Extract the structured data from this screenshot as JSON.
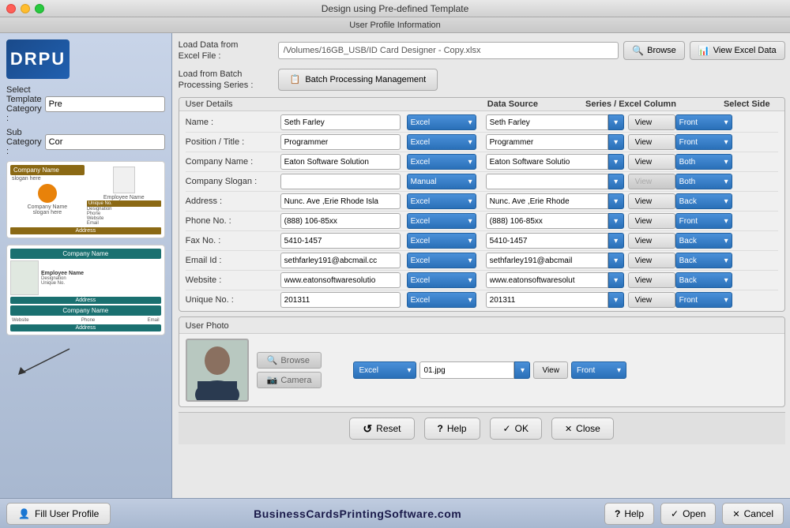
{
  "window": {
    "title": "Design using Pre-defined Template",
    "subtitle": "User Profile Information"
  },
  "sidebar": {
    "logo": "DRPU",
    "select_template_label": "Select Template Category :",
    "select_template_value": "Pre",
    "sub_category_label": "Sub Category :",
    "sub_category_value": "Cor"
  },
  "file_section": {
    "load_data_label": "Load Data from\nExcel File :",
    "file_path": "/Volumes/16GB_USB/ID Card Designer - Copy.xlsx",
    "browse_label": "Browse",
    "view_excel_label": "View Excel Data",
    "load_batch_label": "Load from Batch\nProcessing Series :",
    "batch_label": "Batch Processing Management"
  },
  "user_details": {
    "section_title": "User Details",
    "col_data_source": "Data Source",
    "col_series": "Series / Excel Column",
    "col_select_side": "Select Side",
    "fields": [
      {
        "label": "Name :",
        "value": "Seth Farley",
        "source": "Excel",
        "series_value": "Seth Farley",
        "view": "View",
        "side": "Front"
      },
      {
        "label": "Position / Title :",
        "value": "Programmer",
        "source": "Excel",
        "series_value": "Programmer",
        "view": "View",
        "side": "Front"
      },
      {
        "label": "Company Name :",
        "value": "Eaton Software Solution",
        "source": "Excel",
        "series_value": "Eaton Software Solutio",
        "view": "View",
        "side": "Both"
      },
      {
        "label": "Company Slogan :",
        "value": "",
        "source": "Manual",
        "series_value": "",
        "view": "View",
        "side": "Both",
        "view_disabled": true
      },
      {
        "label": "Address :",
        "value": "Nunc. Ave ,Erie Rhode Isla",
        "source": "Excel",
        "series_value": "Nunc. Ave ,Erie Rhode",
        "view": "View",
        "side": "Back"
      },
      {
        "label": "Phone No. :",
        "value": "(888) 106-85xx",
        "source": "Excel",
        "series_value": "(888) 106-85xx",
        "view": "View",
        "side": "Front"
      },
      {
        "label": "Fax No. :",
        "value": "5410-1457",
        "source": "Excel",
        "series_value": "5410-1457",
        "view": "View",
        "side": "Back"
      },
      {
        "label": "Email Id :",
        "value": "sethfarley191@abcmail.cc",
        "source": "Excel",
        "series_value": "sethfarley191@abcmail",
        "view": "View",
        "side": "Back"
      },
      {
        "label": "Website :",
        "value": "www.eatonsoftwaresolutio",
        "source": "Excel",
        "series_value": "www.eatonsoftwaresolut",
        "view": "View",
        "side": "Back"
      },
      {
        "label": "Unique No. :",
        "value": "201311",
        "source": "Excel",
        "series_value": "201311",
        "view": "View",
        "side": "Front"
      }
    ]
  },
  "user_photo": {
    "section_title": "User Photo",
    "browse_label": "Browse",
    "camera_label": "Camera",
    "source": "Excel",
    "photo_file": "01.jpg",
    "view": "View",
    "side": "Front"
  },
  "bottom_buttons": {
    "reset": "Reset",
    "help": "Help",
    "ok": "OK",
    "close": "Close"
  },
  "status_bar": {
    "fill_profile": "Fill User Profile",
    "website": "BusinessCardsPrintingSoftware.com",
    "help": "Help",
    "open": "Open",
    "cancel": "Cancel"
  }
}
